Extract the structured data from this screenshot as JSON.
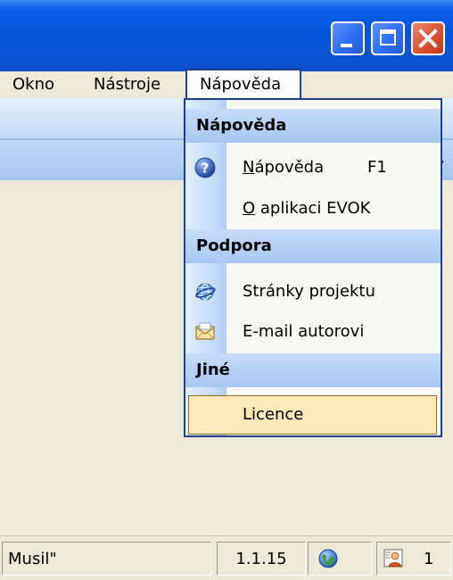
{
  "menubar": {
    "items": [
      {
        "label": "Okno"
      },
      {
        "label": "Nástroje"
      },
      {
        "label": "Nápověda"
      }
    ]
  },
  "dropdown": {
    "sections": [
      {
        "title": "Nápověda"
      },
      {
        "title": "Podpora"
      },
      {
        "title": "Jiné"
      }
    ],
    "help_item": {
      "mnemonic": "N",
      "rest": "ápověda",
      "shortcut": "F1",
      "icon": "help-icon"
    },
    "about_item": {
      "mnemonic": "O",
      "rest": " aplikaci EVOK"
    },
    "web_item": {
      "label": "Stránky projektu",
      "icon": "web-globe-icon"
    },
    "email_item": {
      "label": "E-mail autorovi",
      "icon": "envelope-icon"
    },
    "license_item": {
      "label": "Licence",
      "highlighted": true
    }
  },
  "statusbar": {
    "left_text": "Musil\"",
    "version": "1.1.15",
    "globe_icon": "globe-icon",
    "users_icon": "users-icon",
    "count": "1"
  },
  "colors": {
    "titlebar": "#0553dc",
    "menu_border": "#1f3f87",
    "section_header": "#a9c7f0",
    "highlight": "#fde8b8",
    "close_button": "#dc5131"
  }
}
